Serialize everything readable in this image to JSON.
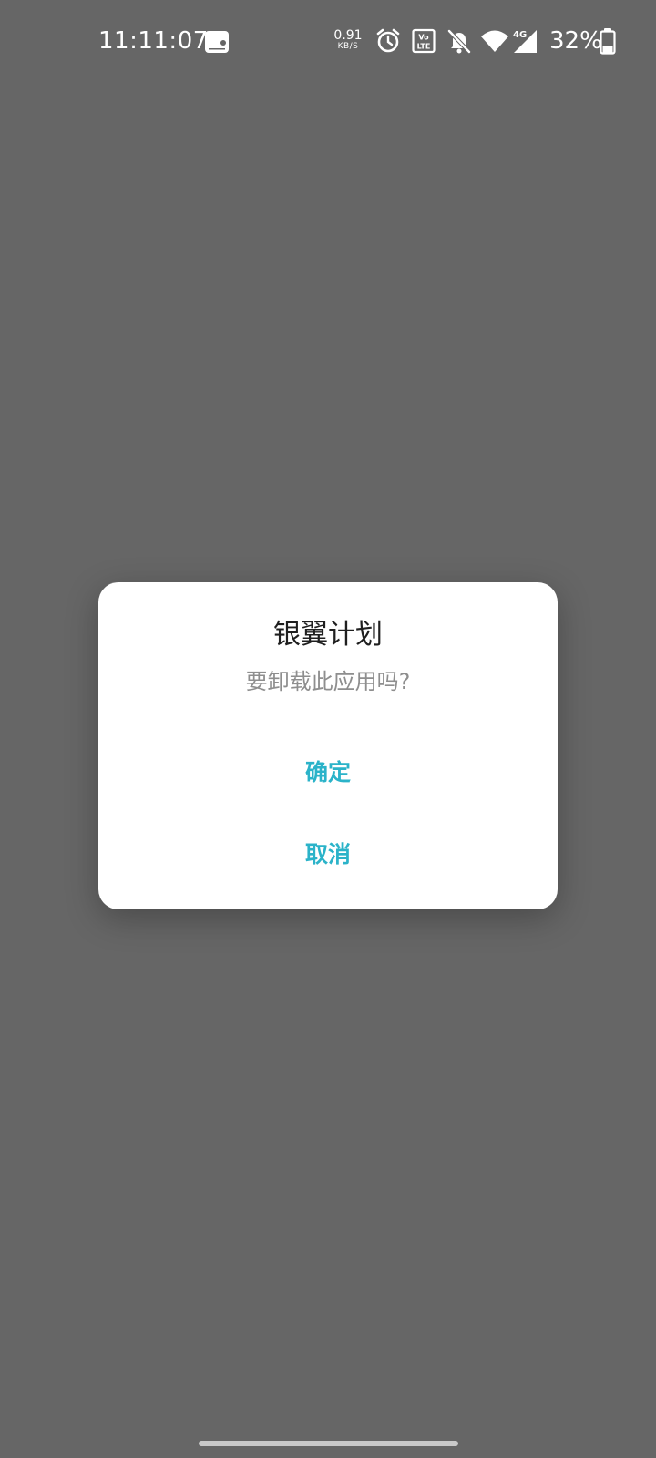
{
  "status_bar": {
    "time": "11:11:07",
    "net_speed_value": "0.91",
    "net_speed_unit": "KB/S",
    "volte_label": "Vo LTE",
    "network_type": "4G",
    "battery_percent": "32%",
    "icons": [
      "screen-recorder-icon",
      "alarm-icon",
      "volte-icon",
      "notifications-off-icon",
      "wifi-icon",
      "cellular-signal-icon",
      "battery-icon"
    ],
    "battery_level": 0.32
  },
  "dialog": {
    "title": "银翼计划",
    "message": "要卸载此应用吗?",
    "confirm_label": "确定",
    "cancel_label": "取消"
  },
  "colors": {
    "scrim": "#666666",
    "dialog_bg": "#ffffff",
    "accent": "#2bb3c9",
    "title": "#1f1f1f",
    "message": "#8e8e8e"
  }
}
